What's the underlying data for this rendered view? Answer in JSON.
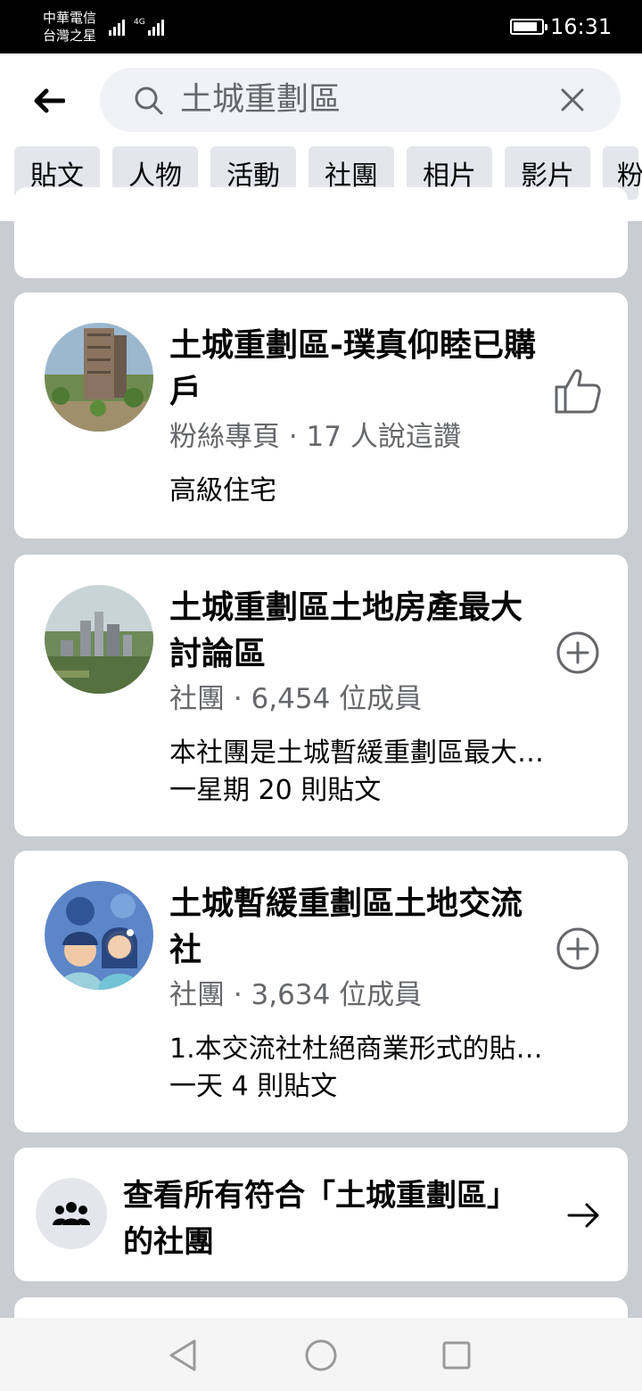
{
  "status_bar": {
    "carrier_1": "中華電信",
    "carrier_2": "台灣之星",
    "network": "4G",
    "time": "16:31"
  },
  "search": {
    "query": "土城重劃區"
  },
  "filters": [
    "貼文",
    "人物",
    "活動",
    "社團",
    "相片",
    "影片",
    "粉"
  ],
  "results": [
    {
      "title": "土城重劃區-璞真仰睦已購戶",
      "meta": "粉絲專頁 · 17 人說這讚",
      "desc": "高級住宅",
      "action_icon": "thumbs-up-icon"
    },
    {
      "title": "土城重劃區土地房產最大討論區",
      "meta": "社團 · 6,454 位成員",
      "desc": "本社團是土城暫緩重劃區最大…",
      "activity": "一星期 20 則貼文",
      "action_icon": "plus-circle-icon"
    },
    {
      "title": "土城暫緩重劃區土地交流社",
      "meta": "社團 · 3,634 位成員",
      "desc": "1.本交流社杜絕商業形式的貼…",
      "activity": "一天 4 則貼文",
      "action_icon": "plus-circle-icon"
    }
  ],
  "see_all": {
    "label": "查看所有符合「土城重劃區」的社團"
  },
  "colors": {
    "background": "#c9ccd1",
    "card": "#ffffff",
    "secondary_text": "#65676b",
    "chip": "#e4e6eb"
  }
}
